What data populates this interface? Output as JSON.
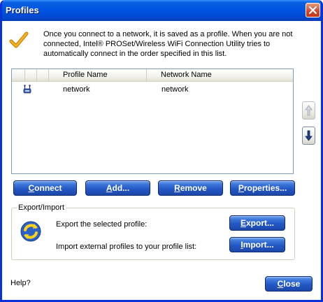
{
  "window": {
    "title": "Profiles",
    "close_label": "Close window"
  },
  "info": {
    "icon": "checkmark-icon",
    "text": "Once you connect to a network, it is saved as a profile. When you are not connected, Intel® PROSet/Wireless WiFi Connection Utility tries to automatically connect in the order specified in this list."
  },
  "list": {
    "columns": [
      "",
      "",
      "",
      "Profile Name",
      "Network Name"
    ],
    "rows": [
      {
        "icon": "wireless-profile-icon",
        "profile_name": "network",
        "network_name": "network"
      }
    ]
  },
  "order_buttons": {
    "up_icon": "arrow-up-icon",
    "down_icon": "arrow-down-icon"
  },
  "buttons": {
    "connect": {
      "underline": "C",
      "rest": "onnect"
    },
    "add": {
      "underline": "A",
      "rest": "dd..."
    },
    "remove": {
      "underline": "R",
      "rest": "emove"
    },
    "properties": {
      "underline": "P",
      "rest": "roperties..."
    },
    "export": {
      "underline": "E",
      "rest": "xport..."
    },
    "import": {
      "underline": "I",
      "rest": "mport..."
    },
    "close": {
      "underline": "C",
      "rest": "lose"
    }
  },
  "export_import": {
    "label": "Export/Import",
    "icon": "sync-arrows-icon",
    "export_text": "Export the selected profile:",
    "import_text": "Import external profiles to your profile list:"
  },
  "help": {
    "label": "Help?"
  },
  "colors": {
    "title_bar": "#0054E3",
    "button": "#2255C4",
    "close_button": "#D2452A",
    "check_icon": "#F0A000"
  }
}
